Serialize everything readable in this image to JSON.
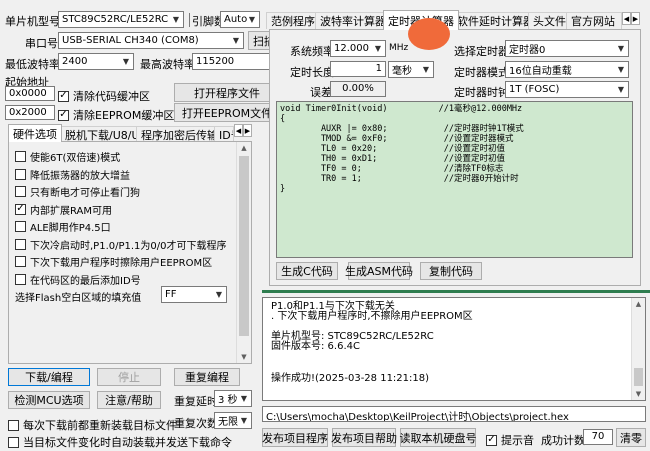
{
  "top": {
    "mcu_label": "单片机型号",
    "mcu_value": "STC89C52RC/LE52RC",
    "pins_label": "引脚数",
    "pins_value": "Auto",
    "port_label": "串口号",
    "port_value": "USB-SERIAL CH340 (COM8)",
    "scan_label": "扫描",
    "min_baud_label": "最低波特率",
    "min_baud_value": "2400",
    "max_baud_label": "最高波特率",
    "max_baud_value": "115200",
    "start_addr_label": "起始地址",
    "addr1": "0x0000",
    "clear_code_label": "清除代码缓冲区",
    "open_prog_label": "打开程序文件",
    "addr2": "0x2000",
    "clear_eeprom_label": "清除EEPROM缓冲区",
    "open_eeprom_label": "打开EEPROM文件"
  },
  "left_tabs": [
    "硬件选项",
    "脱机下载/U8/U7",
    "程序加密后传输",
    "ID号"
  ],
  "options": [
    {
      "label": "使能6T(双倍速)模式",
      "checked": false
    },
    {
      "label": "降低振荡器的放大增益",
      "checked": false
    },
    {
      "label": "只有断电才可停止看门狗",
      "checked": false
    },
    {
      "label": "内部扩展RAM可用",
      "checked": true
    },
    {
      "label": "ALE脚用作P4.5口",
      "checked": false
    },
    {
      "label": "下次冷启动时,P1.0/P1.1为0/0才可下载程序",
      "checked": false
    },
    {
      "label": "下次下载用户程序时擦除用户EEPROM区",
      "checked": false
    },
    {
      "label": "在代码区的最后添加ID号",
      "checked": false
    }
  ],
  "fill": {
    "label": "选择Flash空白区域的填充值",
    "value": "FF"
  },
  "bottom_left": {
    "download": "下载/编程",
    "stop": "停止",
    "reprogram": "重复编程",
    "detect": "检测MCU选项",
    "notes": "注意/帮助",
    "repeat_delay_label": "重复延时",
    "repeat_delay_value": "3 秒",
    "reload_label": "每次下载前都重新装载目标文件",
    "repeat_count_label": "重复次数",
    "repeat_count_value": "无限",
    "auto_load_label": "当目标文件变化时自动装载并发送下载命令"
  },
  "right_tabs": [
    "范例程序",
    "波特率计算器",
    "定时器计算器",
    "软件延时计算器",
    "头文件",
    "官方网站"
  ],
  "timer": {
    "freq_label": "系统频率",
    "freq_value": "12.000",
    "freq_unit": "MHz",
    "select_label": "选择定时器",
    "select_value": "定时器0",
    "length_label": "定时长度",
    "length_value": "1",
    "length_unit": "毫秒",
    "mode_label": "定时器模式",
    "mode_value": "16位自动重载",
    "error_label": "误差",
    "error_value": "0.00%",
    "clock_label": "定时器时钟",
    "clock_value": "1T  (FOSC)",
    "code": "void Timer0Init(void)          //1毫秒@12.000MHz\n{\n        AUXR |= 0x80;           //定时器时钟1T模式\n        TMOD &= 0xF0;           //设置定时器模式\n        TL0 = 0x20;             //设置定时初值\n        TH0 = 0xD1;             //设置定时初值\n        TF0 = 0;                //清除TF0标志\n        TR0 = 1;                //定时器0开始计时\n}",
    "gen_c": "生成C代码",
    "gen_asm": "生成ASM代码",
    "copy": "复制代码"
  },
  "log": {
    "lines": [
      "P1.0和P1.1与下次下载无关",
      ". 下次下载用户程序时,不擦除用户EEPROM区",
      "",
      "单片机型号: STC89C52RC/LE52RC",
      "固件版本号: 6.6.4C",
      "",
      "",
      "操作成功!(2025-03-28 11:21:18)"
    ]
  },
  "path": "C:\\Users\\mocha\\Desktop\\KeilProject\\计时\\Objects\\project.hex",
  "bottom_right": {
    "publish": "发布项目程序",
    "publish_help": "发布项目帮助",
    "read_disk": "读取本机硬盘号",
    "hint_label": "提示音",
    "success_label": "成功计数",
    "success_value": "70",
    "clear": "清零"
  },
  "colors": {
    "accent_blob": "#f06a3a",
    "divider": "#2e7d4f",
    "code_bg": "#cfe8cf"
  }
}
